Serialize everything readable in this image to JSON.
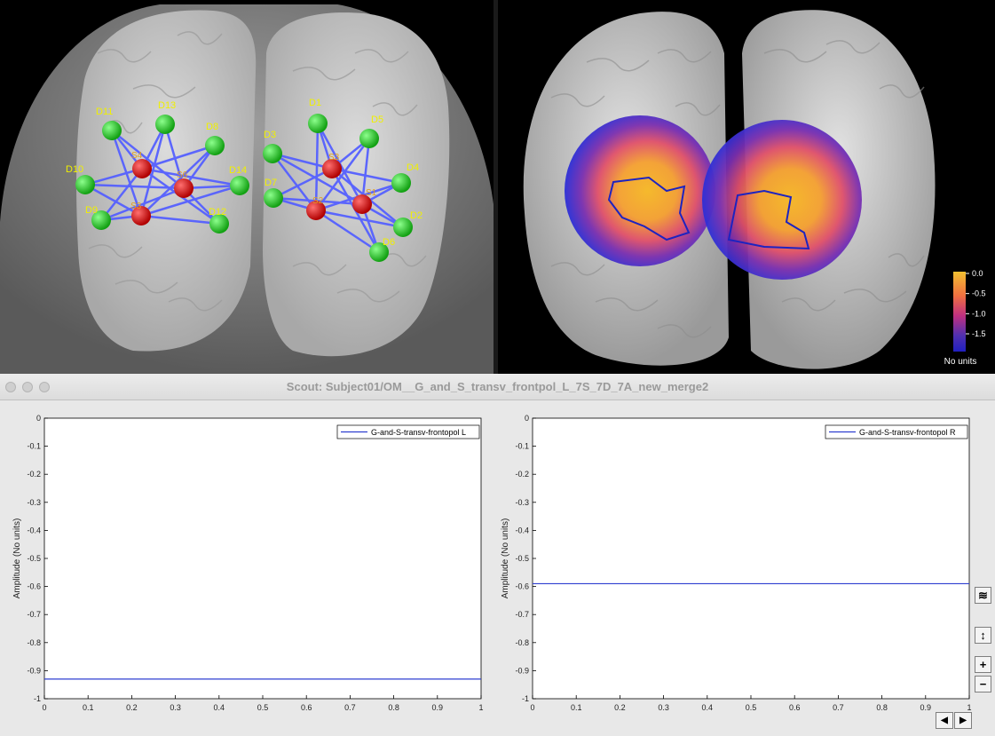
{
  "window": {
    "title": "Scout: Subject01/OM__G_and_S_transv_frontpol_L_7S_7D_7A_new_merge2"
  },
  "left_view": {
    "detectors": [
      {
        "label": "D11"
      },
      {
        "label": "D13"
      },
      {
        "label": "D8"
      },
      {
        "label": "D10"
      },
      {
        "label": "D14"
      },
      {
        "label": "D9"
      },
      {
        "label": "D12"
      },
      {
        "label": "D1"
      },
      {
        "label": "D5"
      },
      {
        "label": "D3"
      },
      {
        "label": "D4"
      },
      {
        "label": "D7"
      },
      {
        "label": "D2"
      },
      {
        "label": "D6"
      }
    ],
    "sources": [
      {
        "label": "S4"
      },
      {
        "label": "S6"
      },
      {
        "label": "S3"
      },
      {
        "label": "S3"
      },
      {
        "label": "S2"
      },
      {
        "label": "S1"
      }
    ]
  },
  "right_view": {
    "colorbar": {
      "ticks": [
        "0.0",
        "-0.5",
        "-1.0",
        "-1.5"
      ],
      "unit_label": "No units"
    }
  },
  "plots": {
    "y_axis_label": "Amplitude (No units)",
    "x_ticks": [
      "0",
      "0.1",
      "0.2",
      "0.3",
      "0.4",
      "0.5",
      "0.6",
      "0.7",
      "0.8",
      "0.9",
      "1"
    ],
    "y_ticks": [
      "0",
      "-0.1",
      "-0.2",
      "-0.3",
      "-0.4",
      "-0.5",
      "-0.6",
      "-0.7",
      "-0.8",
      "-0.9",
      "-1"
    ],
    "left": {
      "legend": "G-and-S-transv-frontopol L",
      "value": -0.93
    },
    "right": {
      "legend": "G-and-S-transv-frontopol R",
      "value": -0.59
    }
  },
  "chart_data": [
    {
      "type": "line",
      "series": [
        {
          "name": "G-and-S-transv-frontopol L",
          "x": [
            0,
            1
          ],
          "y": [
            -0.93,
            -0.93
          ]
        }
      ],
      "xlabel": "",
      "ylabel": "Amplitude (No units)",
      "xlim": [
        0,
        1
      ],
      "ylim": [
        -1,
        0
      ],
      "grid": false,
      "legend": "top-right"
    },
    {
      "type": "line",
      "series": [
        {
          "name": "G-and-S-transv-frontopol R",
          "x": [
            0,
            1
          ],
          "y": [
            -0.59,
            -0.59
          ]
        }
      ],
      "xlabel": "",
      "ylabel": "Amplitude (No units)",
      "xlim": [
        0,
        1
      ],
      "ylim": [
        -1,
        0
      ],
      "grid": false,
      "legend": "top-right"
    }
  ],
  "colors": {
    "trace": "#2f3fd0",
    "detector": "#2ecc2e",
    "source": "#e01010",
    "optode_label": "#f0f000",
    "connection": "#5560ff"
  },
  "toolbar": {
    "icons": [
      "amplitude-scale-icon",
      "axis-adjust-icon",
      "zoom-in-icon",
      "zoom-out-icon",
      "scroll-left-icon",
      "scroll-right-icon"
    ],
    "zoom_in_label": "+",
    "zoom_out_label": "−",
    "left_arrow": "◀",
    "right_arrow": "▶"
  }
}
